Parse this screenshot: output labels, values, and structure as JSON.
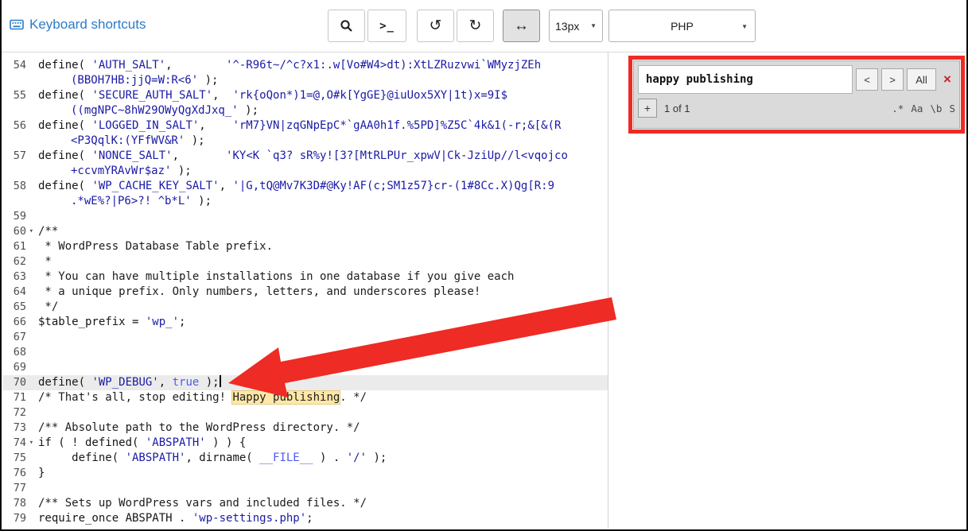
{
  "topbar": {
    "shortcuts_label": "Keyboard shortcuts",
    "font_size_value": "13px",
    "language_value": "PHP"
  },
  "icons": {
    "terminal": ">_",
    "undo": "↺",
    "redo": "↻",
    "wrap": "↔",
    "chevron": "▼",
    "fold": "▾"
  },
  "searchbox": {
    "query": "happy publishing",
    "prev_label": "<",
    "next_label": ">",
    "all_label": "All",
    "close_label": "×",
    "toggle_replace_label": "+",
    "counter": "1 of 1",
    "options": [
      ".*",
      "Aa",
      "\\b",
      "S"
    ]
  },
  "colors": {
    "annotation_red": "#ee2b24",
    "string_blue": "#1a1aa6",
    "atom_blue": "#4d5cf0",
    "link_blue": "#2b7cc9",
    "active_line": "#ebebeb"
  },
  "editor": {
    "rows": [
      {
        "ln": "54",
        "tokens": [
          {
            "t": "define( ",
            "c": "d"
          },
          {
            "t": "'AUTH_SALT'",
            "c": "s"
          },
          {
            "t": ",        ",
            "c": "d"
          },
          {
            "t": "'^-R96t~/^c?x1:.w[Vo#W4>dt):XtLZRuzvwi`WMyzjZEh",
            "c": "s"
          }
        ]
      },
      {
        "wrap": true,
        "tokens": [
          {
            "t": "(BBOH7HB:jjQ=W:R<6'",
            "c": "s"
          },
          {
            "t": " );",
            "c": "d"
          }
        ]
      },
      {
        "ln": "55",
        "tokens": [
          {
            "t": "define( ",
            "c": "d"
          },
          {
            "t": "'SECURE_AUTH_SALT'",
            "c": "s"
          },
          {
            "t": ",  ",
            "c": "d"
          },
          {
            "t": "'rk{oQon*)1=@,O#k[YgGE}@iuUox5XY|1t)x=9I$",
            "c": "s"
          }
        ]
      },
      {
        "wrap": true,
        "tokens": [
          {
            "t": "((mgNPC~8hW29OWyQgXdJxq_'",
            "c": "s"
          },
          {
            "t": " );",
            "c": "d"
          }
        ]
      },
      {
        "ln": "56",
        "tokens": [
          {
            "t": "define( ",
            "c": "d"
          },
          {
            "t": "'LOGGED_IN_SALT'",
            "c": "s"
          },
          {
            "t": ",    ",
            "c": "d"
          },
          {
            "t": "'rM7}VN|zqGNpEpC*`gAA0h1f.%5PD]%Z5C`4k&1(-r;&[&(R",
            "c": "s"
          }
        ]
      },
      {
        "wrap": true,
        "tokens": [
          {
            "t": "<P3QqlK:(YFfWV&R'",
            "c": "s"
          },
          {
            "t": " );",
            "c": "d"
          }
        ]
      },
      {
        "ln": "57",
        "tokens": [
          {
            "t": "define( ",
            "c": "d"
          },
          {
            "t": "'NONCE_SALT'",
            "c": "s"
          },
          {
            "t": ",       ",
            "c": "d"
          },
          {
            "t": "'KY<K `q3? sR%y![3?[MtRLPUr_xpwV|Ck-JziUp//l<vqojco",
            "c": "s"
          }
        ]
      },
      {
        "wrap": true,
        "tokens": [
          {
            "t": "+ccvmYRAvWr$az'",
            "c": "s"
          },
          {
            "t": " );",
            "c": "d"
          }
        ]
      },
      {
        "ln": "58",
        "tokens": [
          {
            "t": "define( ",
            "c": "d"
          },
          {
            "t": "'WP_CACHE_KEY_SALT'",
            "c": "s"
          },
          {
            "t": ", ",
            "c": "d"
          },
          {
            "t": "'|G,tQ@Mv7K3D#@Ky!AF(c;SM1z57}cr-(1#8Cc.X)Qg[R:9",
            "c": "s"
          }
        ]
      },
      {
        "wrap": true,
        "tokens": [
          {
            "t": ".*wE%?|P6>?! ^b*L'",
            "c": "s"
          },
          {
            "t": " );",
            "c": "d"
          }
        ]
      },
      {
        "ln": "59",
        "tokens": []
      },
      {
        "ln": "60",
        "fold": true,
        "tokens": [
          {
            "t": "/**",
            "c": "c"
          }
        ]
      },
      {
        "ln": "61",
        "tokens": [
          {
            "t": " * WordPress Database Table prefix.",
            "c": "c"
          }
        ]
      },
      {
        "ln": "62",
        "tokens": [
          {
            "t": " *",
            "c": "c"
          }
        ]
      },
      {
        "ln": "63",
        "tokens": [
          {
            "t": " * You can have multiple installations in one database if you give each",
            "c": "c"
          }
        ]
      },
      {
        "ln": "64",
        "tokens": [
          {
            "t": " * a unique prefix. Only numbers, letters, and underscores please!",
            "c": "c"
          }
        ]
      },
      {
        "ln": "65",
        "tokens": [
          {
            "t": " */",
            "c": "c"
          }
        ]
      },
      {
        "ln": "66",
        "tokens": [
          {
            "t": "$table_prefix",
            "c": "d"
          },
          {
            "t": " = ",
            "c": "d"
          },
          {
            "t": "'wp_'",
            "c": "s"
          },
          {
            "t": ";",
            "c": "d"
          }
        ]
      },
      {
        "ln": "67",
        "tokens": []
      },
      {
        "ln": "68",
        "tokens": []
      },
      {
        "ln": "69",
        "tokens": []
      },
      {
        "ln": "70",
        "active": true,
        "cursor": true,
        "tokens": [
          {
            "t": "define( ",
            "c": "d"
          },
          {
            "t": "'WP_DEBUG'",
            "c": "s"
          },
          {
            "t": ", ",
            "c": "d"
          },
          {
            "t": "true",
            "c": "a"
          },
          {
            "t": " );",
            "c": "d"
          }
        ]
      },
      {
        "ln": "71",
        "tokens": [
          {
            "t": "/* That's all, stop editing! ",
            "c": "c"
          },
          {
            "t": "Happy publishing",
            "c": "m"
          },
          {
            "t": ". */",
            "c": "c"
          }
        ]
      },
      {
        "ln": "72",
        "tokens": []
      },
      {
        "ln": "73",
        "tokens": [
          {
            "t": "/** Absolute path to the WordPress directory. */",
            "c": "c"
          }
        ]
      },
      {
        "ln": "74",
        "fold": true,
        "tokens": [
          {
            "t": "if ( ! defined( ",
            "c": "d"
          },
          {
            "t": "'ABSPATH'",
            "c": "s"
          },
          {
            "t": " ) ) {",
            "c": "d"
          }
        ]
      },
      {
        "ln": "75",
        "tokens": [
          {
            "t": "     define( ",
            "c": "d"
          },
          {
            "t": "'ABSPATH'",
            "c": "s"
          },
          {
            "t": ", dirname( ",
            "c": "d"
          },
          {
            "t": "__FILE__",
            "c": "a"
          },
          {
            "t": " ) . ",
            "c": "d"
          },
          {
            "t": "'/'",
            "c": "s"
          },
          {
            "t": " );",
            "c": "d"
          }
        ]
      },
      {
        "ln": "76",
        "tokens": [
          {
            "t": "}",
            "c": "d"
          }
        ]
      },
      {
        "ln": "77",
        "tokens": []
      },
      {
        "ln": "78",
        "tokens": [
          {
            "t": "/** Sets up WordPress vars and included files. */",
            "c": "c"
          }
        ]
      },
      {
        "ln": "79",
        "tokens": [
          {
            "t": "require_once ABSPATH . ",
            "c": "d"
          },
          {
            "t": "'wp-settings.php'",
            "c": "s"
          },
          {
            "t": ";",
            "c": "d"
          }
        ]
      }
    ]
  }
}
